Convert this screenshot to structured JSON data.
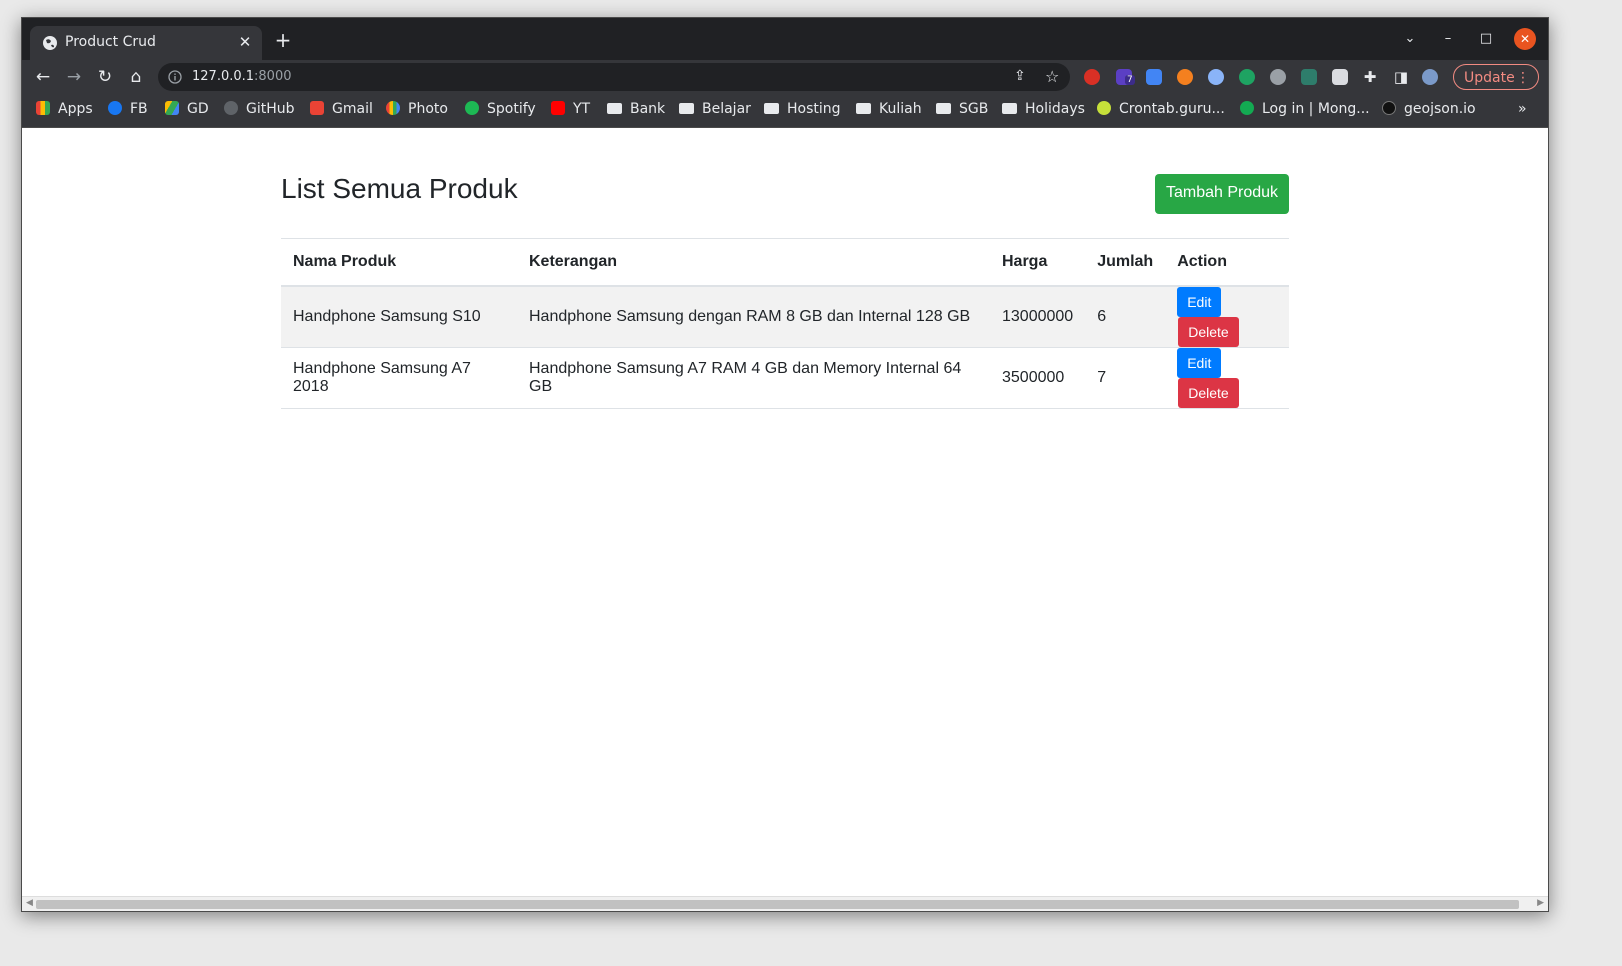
{
  "browser": {
    "tab_title": "Product Crud",
    "url_host": "127.0.0.1",
    "url_port": ":8000",
    "update_label": "Update",
    "bookmarks": [
      "Apps",
      "FB",
      "GD",
      "GitHub",
      "Gmail",
      "Photo",
      "Spotify",
      "YT",
      "Bank",
      "Belajar",
      "Hosting",
      "Kuliah",
      "SGB",
      "Holidays",
      "Crontab.guru...",
      "Log in | Mong...",
      "geojson.io"
    ],
    "more_bookmarks": "»",
    "extension_badge": "7"
  },
  "page": {
    "title": "List Semua Produk",
    "add_button": "Tambah Produk",
    "table": {
      "headers": [
        "Nama Produk",
        "Keterangan",
        "Harga",
        "Jumlah",
        "Action"
      ],
      "rows": [
        {
          "nama": "Handphone Samsung S10",
          "keterangan": "Handphone Samsung dengan RAM 8 GB dan Internal 128 GB",
          "harga": "13000000",
          "jumlah": "6"
        },
        {
          "nama": "Handphone Samsung A7 2018",
          "keterangan": "Handphone Samsung A7 RAM 4 GB dan Memory Internal 64 GB",
          "harga": "3500000",
          "jumlah": "7"
        }
      ],
      "edit_label": "Edit",
      "delete_label": "Delete"
    }
  },
  "colors": {
    "success": "#28a745",
    "primary": "#007bff",
    "danger": "#dc3545"
  }
}
